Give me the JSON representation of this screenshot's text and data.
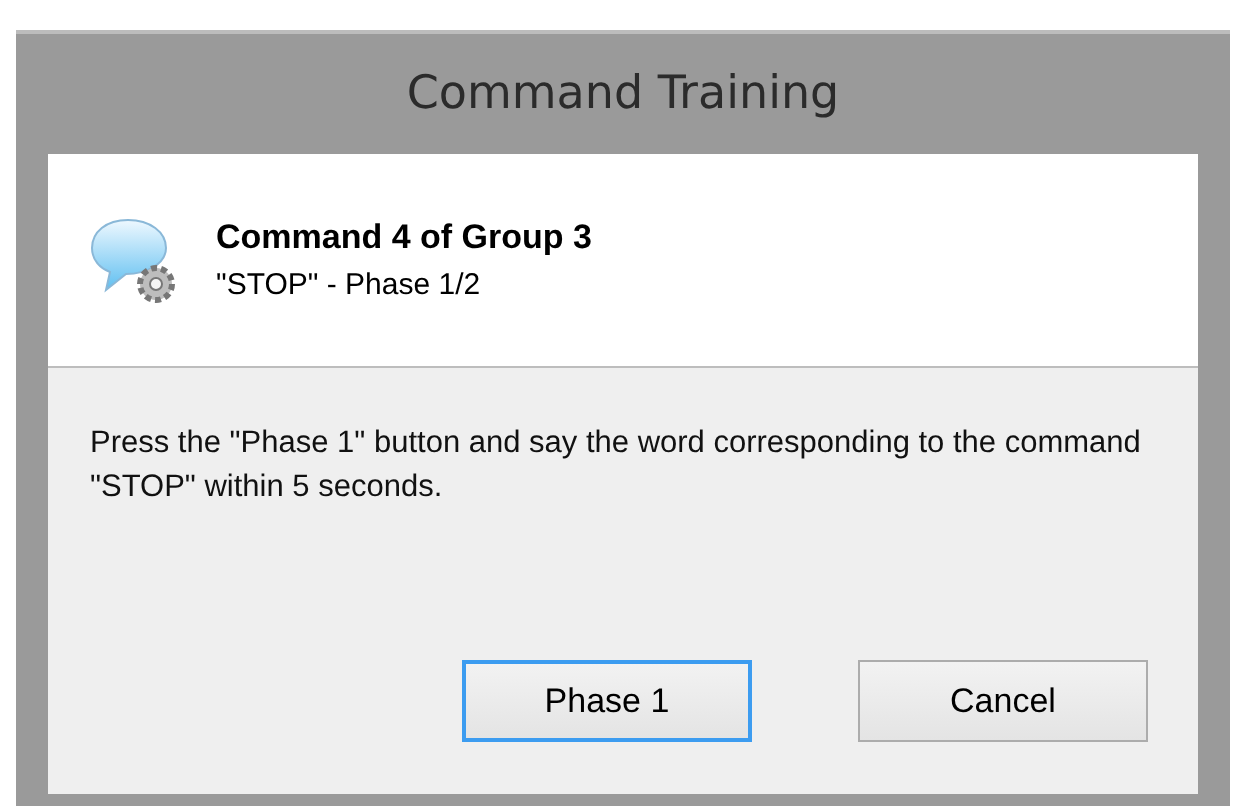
{
  "window": {
    "title": "Command Training"
  },
  "header": {
    "title": "Command 4 of Group 3",
    "subtitle": "\"STOP\" - Phase 1/2"
  },
  "message": "Press the \"Phase 1\" button and say the word corresponding to the command \"STOP\" within 5 seconds.",
  "buttons": [
    {
      "label": "Phase 1",
      "default": true
    },
    {
      "label": "Cancel",
      "default": false
    }
  ]
}
